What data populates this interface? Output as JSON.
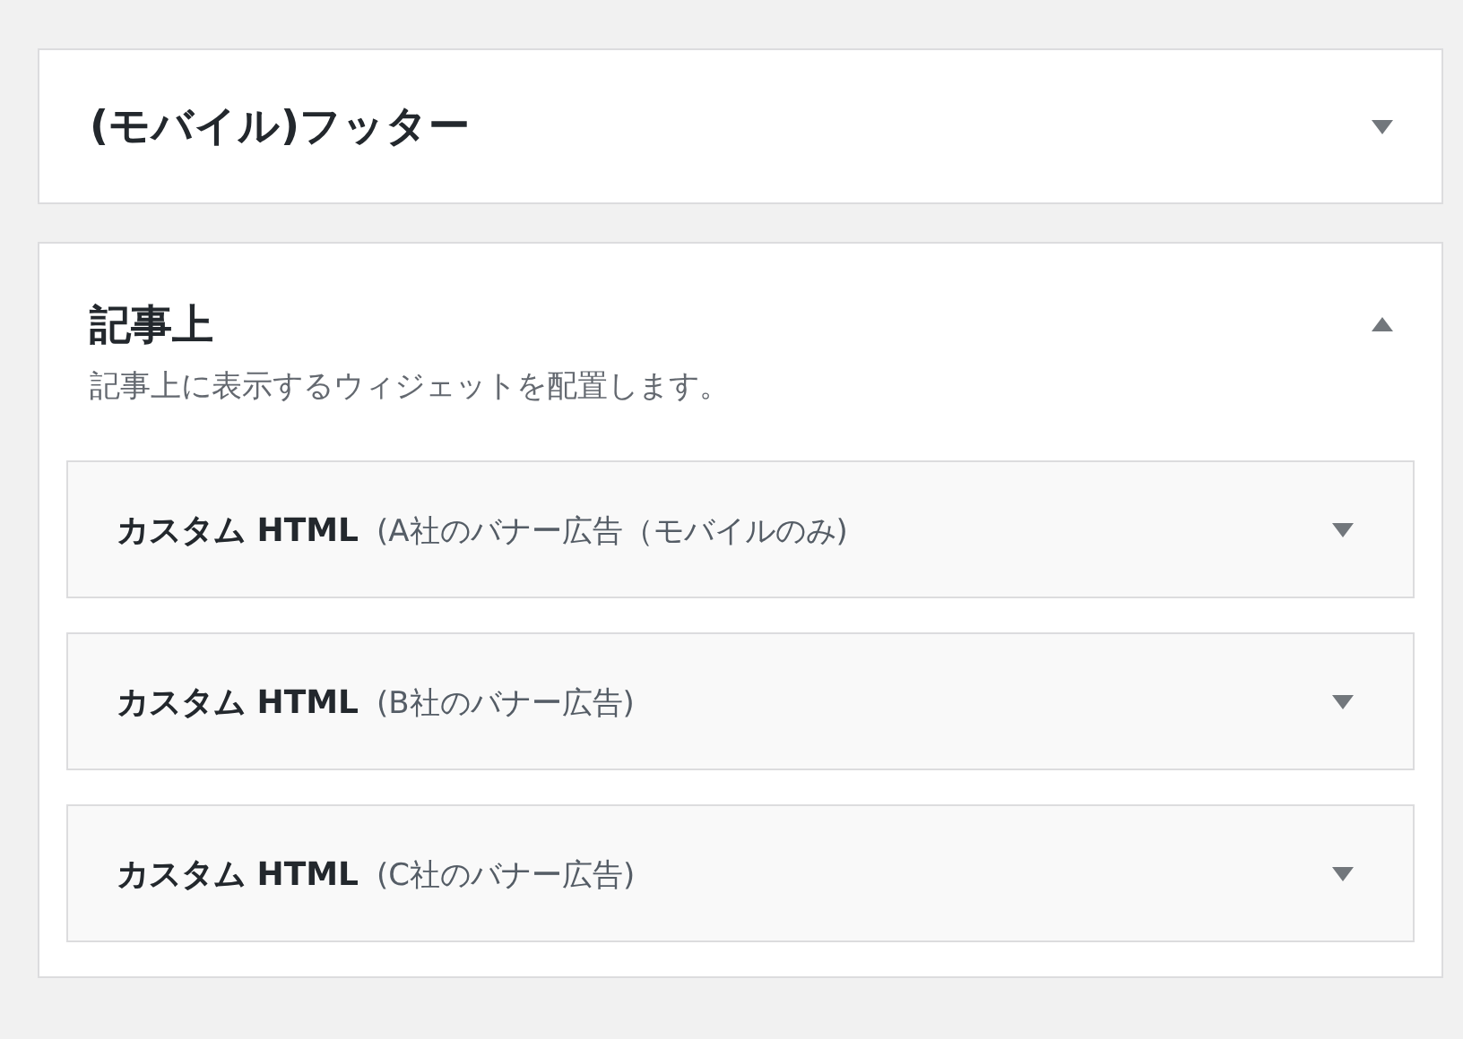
{
  "sidebars": [
    {
      "title": "(モバイル)フッター",
      "expanded": false
    },
    {
      "title": "記事上",
      "expanded": true,
      "description": "記事上に表示するウィジェットを配置します。",
      "widgets": [
        {
          "name": "カスタム HTML",
          "title": "(A社のバナー広告（モバイルのみ)",
          "expanded": false
        },
        {
          "name": "カスタム HTML",
          "title": "(B社のバナー広告)",
          "expanded": false
        },
        {
          "name": "カスタム HTML",
          "title": "(C社のバナー広告)",
          "expanded": false
        }
      ]
    }
  ]
}
